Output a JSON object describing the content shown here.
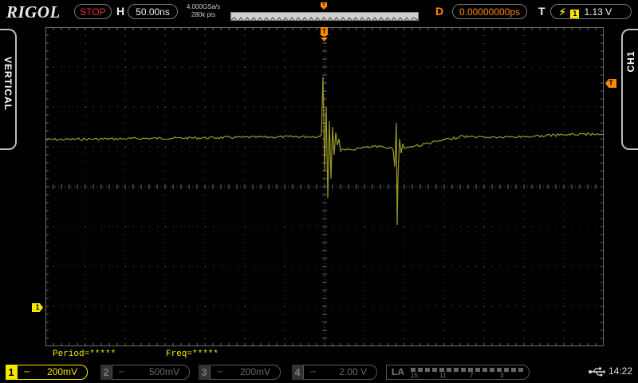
{
  "brand": "RIGOL",
  "run_status": "STOP",
  "horizontal": {
    "label": "H",
    "timebase": "50.00ns",
    "sample_rate": "4.000GSa/s",
    "memory_depth": "280k pts"
  },
  "delay": {
    "label": "D",
    "value": "0.00000000ps"
  },
  "trigger": {
    "label": "T",
    "source": "1",
    "level": "1.13 V",
    "slope": "rising-edge-icon"
  },
  "side_tabs": {
    "left": "VERTICAL",
    "right": "CH1"
  },
  "markers": {
    "ch1": "1",
    "trigger_level": "T",
    "trigger_pos": "T"
  },
  "measurements": {
    "period": "Period=*****",
    "freq": "Freq=*****"
  },
  "channels": [
    {
      "num": "1",
      "coupling": "⎓",
      "scale": "200mV",
      "active": true
    },
    {
      "num": "2",
      "coupling": "⎓",
      "scale": "500mV",
      "active": false
    },
    {
      "num": "3",
      "coupling": "⎓",
      "scale": "200mV",
      "active": false
    },
    {
      "num": "4",
      "coupling": "⎓",
      "scale": "2.00 V",
      "active": false
    }
  ],
  "logic_analyzer": {
    "label": "LA",
    "indices": [
      "15",
      "11",
      "7",
      "3"
    ]
  },
  "clock": "14:22",
  "colors": {
    "ch1": "#f5e800",
    "trace": "#9a9a2a",
    "accent": "#ff8a00",
    "stop": "#e0302a",
    "grid": "#6a6a6a"
  }
}
